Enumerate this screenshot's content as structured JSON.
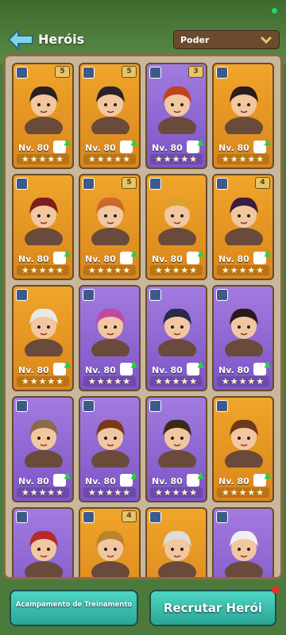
{
  "header": {
    "title": "Heróis",
    "sort_dropdown": "Poder"
  },
  "heroes": [
    {
      "level": "Nv. 80",
      "tier": "5",
      "color": "gold",
      "stars": "★★★★★"
    },
    {
      "level": "Nv. 80",
      "tier": "5",
      "color": "gold",
      "stars": "★★★★★"
    },
    {
      "level": "Nv. 80",
      "tier": "3",
      "color": "purple",
      "stars": "★★★★★"
    },
    {
      "level": "Nv. 80",
      "tier": "",
      "color": "gold",
      "stars": "★★★★★"
    },
    {
      "level": "Nv. 80",
      "tier": "",
      "color": "gold",
      "stars": "★★★★★"
    },
    {
      "level": "Nv. 80",
      "tier": "5",
      "color": "gold",
      "stars": "★★★★★"
    },
    {
      "level": "Nv. 80",
      "tier": "",
      "color": "gold",
      "stars": "★★★★★"
    },
    {
      "level": "Nv. 80",
      "tier": "4",
      "color": "gold",
      "stars": "★★★★★"
    },
    {
      "level": "Nv. 80",
      "tier": "",
      "color": "gold",
      "stars": "★★★★★"
    },
    {
      "level": "Nv. 80",
      "tier": "",
      "color": "purple",
      "stars": "★★★★★"
    },
    {
      "level": "Nv. 80",
      "tier": "",
      "color": "purple",
      "stars": "★★★★★"
    },
    {
      "level": "Nv. 80",
      "tier": "",
      "color": "purple",
      "stars": "★★★★★"
    },
    {
      "level": "Nv. 80",
      "tier": "",
      "color": "purple",
      "stars": "★★★★★"
    },
    {
      "level": "Nv. 80",
      "tier": "",
      "color": "purple",
      "stars": "★★★★★"
    },
    {
      "level": "Nv. 80",
      "tier": "",
      "color": "purple",
      "stars": "★★★★★"
    },
    {
      "level": "Nv. 80",
      "tier": "",
      "color": "gold",
      "stars": "★★★★★"
    },
    {
      "level": "",
      "tier": "",
      "color": "purple",
      "stars": ""
    },
    {
      "level": "",
      "tier": "4",
      "color": "gold",
      "stars": ""
    },
    {
      "level": "",
      "tier": "",
      "color": "gold",
      "stars": ""
    },
    {
      "level": "",
      "tier": "",
      "color": "purple",
      "stars": ""
    }
  ],
  "buttons": {
    "training_camp": "Acampamento de Treinamento",
    "recruit": "Recrutar Herói"
  }
}
